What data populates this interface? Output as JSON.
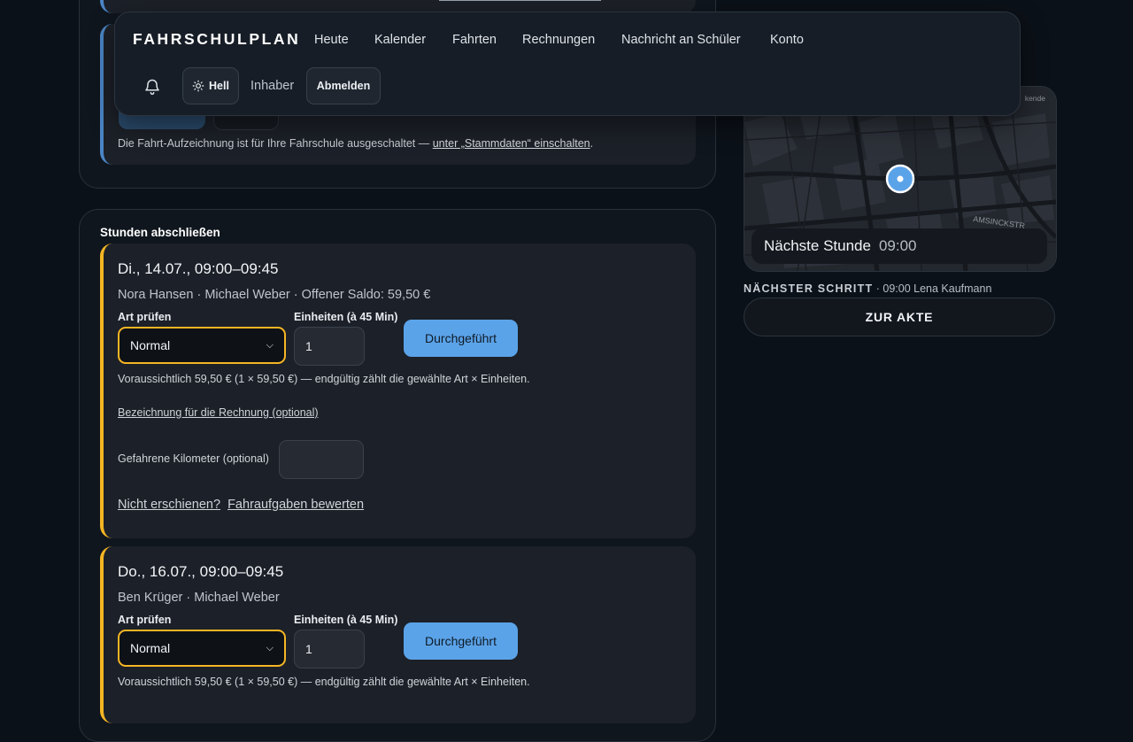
{
  "nav": {
    "brand": "FAHRSCHULPLAN",
    "links": [
      "Heute",
      "Kalender",
      "Fahrten",
      "Rechnungen",
      "Nachricht an Schüler",
      "Konto"
    ],
    "theme_label": "Hell",
    "role": "Inhaber",
    "logout": "Abmelden",
    "icons": {
      "bell": "bell-icon",
      "theme": "sun-icon"
    }
  },
  "recording": {
    "note_prefix": "Die Fahrt-Aufzeichnung ist für Ihre Fahrschule ausgeschaltet — ",
    "note_link": "unter „Stammdaten“ einschalten",
    "note_suffix": "."
  },
  "lessons_section": {
    "title": "Stunden abschließen",
    "lessons": [
      {
        "title": "Di., 14.07., 09:00–09:45",
        "meta": "Nora Hansen · Michael Weber · Offener Saldo: 59,50 €",
        "type_label": "Art prüfen",
        "type_value": "Normal",
        "units_label": "Einheiten (à 45 Min)",
        "units_value": "1",
        "done_label": "Durchgeführt",
        "estimate": "Voraussichtlich 59,50 € (1 × 59,50 €) — endgültig zählt die gewählte Art × Einheiten.",
        "invoice_link": "Bezeichnung für die Rechnung (optional)",
        "km_label": "Gefahrene Kilometer (optional)",
        "no_show_link": "Nicht erschienen?",
        "rate_link": "Fahraufgaben bewerten"
      },
      {
        "title": "Do., 16.07., 09:00–09:45",
        "meta": "Ben Krüger · Michael Weber",
        "type_label": "Art prüfen",
        "type_value": "Normal",
        "units_label": "Einheiten (à 45 Min)",
        "units_value": "1",
        "done_label": "Durchgeführt",
        "estimate": "Voraussichtlich 59,50 € (1 × 59,50 €) — endgültig zählt die gewählte Art × Einheiten."
      }
    ]
  },
  "map": {
    "attribution": "kende",
    "street": "AMSINCKSTR",
    "next_label": "Nächste Stunde",
    "next_time": "09:00"
  },
  "next_step": {
    "heading": "NÄCHSTER SCHRITT",
    "text": " · 09:00 Lena Kaufmann"
  },
  "akte_button": "ZUR AKTE",
  "colors": {
    "accent_yellow": "#f5b524",
    "accent_blue": "#5ba3e8",
    "background": "#0b1118"
  }
}
